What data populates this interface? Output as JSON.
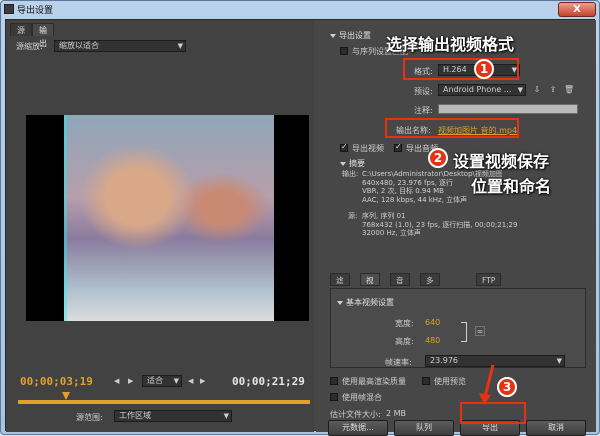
{
  "window": {
    "title": "导出设置",
    "close_label": "X"
  },
  "left": {
    "tabs": [
      "源",
      "输出"
    ],
    "source_scale_label": "源缩放:",
    "source_scale_value": "缩放以适合",
    "timecode_current": "00;00;03;19",
    "timecode_total": "00;00;21;29",
    "fit_value": "适合",
    "range_label": "源范围:",
    "range_value": "工作区域"
  },
  "export_settings": {
    "header": "导出设置",
    "match_sequence_label": "与序列设置匹配",
    "format_label": "格式:",
    "format_value": "H.264",
    "preset_label": "预设:",
    "preset_value": "Android Phone ...",
    "comment_label": "注释:",
    "output_name_label": "输出名称:",
    "output_name_value": "视频加图片 音的.mp4",
    "export_video_label": "导出视频",
    "export_audio_label": "导出音频"
  },
  "summary": {
    "header": "摘要",
    "output_label": "输出:",
    "output_lines": [
      "C:\\Users\\Administrator\\Desktop\\视频加图片 音的.mp4",
      "640x480, 23.976 fps, 逐行",
      "VBR, 2 次, 目标 0.94 MB",
      "AAC, 128 kbps, 44 kHz, 立体声"
    ],
    "source_label": "源:",
    "source_lines": [
      "序列, 序列 01",
      "768x432 (1.0), 23 fps, 逐行扫描, 00;00;21;29",
      "32000 Hz, 立体声"
    ]
  },
  "right_tabs": [
    "滤镜",
    "视频",
    "音频",
    "多路复用器",
    "FTP"
  ],
  "video": {
    "basic_header": "基本视频设置",
    "width_label": "宽度:",
    "width_value": "640",
    "height_label": "高度:",
    "height_value": "480",
    "framerate_label": "帧速率:",
    "framerate_value": "23.976"
  },
  "options": {
    "max_quality_label": "使用最高渲染质量",
    "preview_label": "使用预览",
    "frame_blend_label": "使用帧混合",
    "file_size_label": "估计文件大小:",
    "file_size_value": "2 MB"
  },
  "buttons": {
    "metadata": "元数据...",
    "queue": "队列",
    "export": "导出",
    "cancel": "取消"
  },
  "annotations": {
    "step1": "选择输出视频格式",
    "step2_line1": "设置视频保存",
    "step2_line2": "位置和命名",
    "n1": "1",
    "n2": "2",
    "n3": "3"
  },
  "colors": {
    "accent_orange": "#e2a126",
    "annotation_red": "#e53212"
  }
}
